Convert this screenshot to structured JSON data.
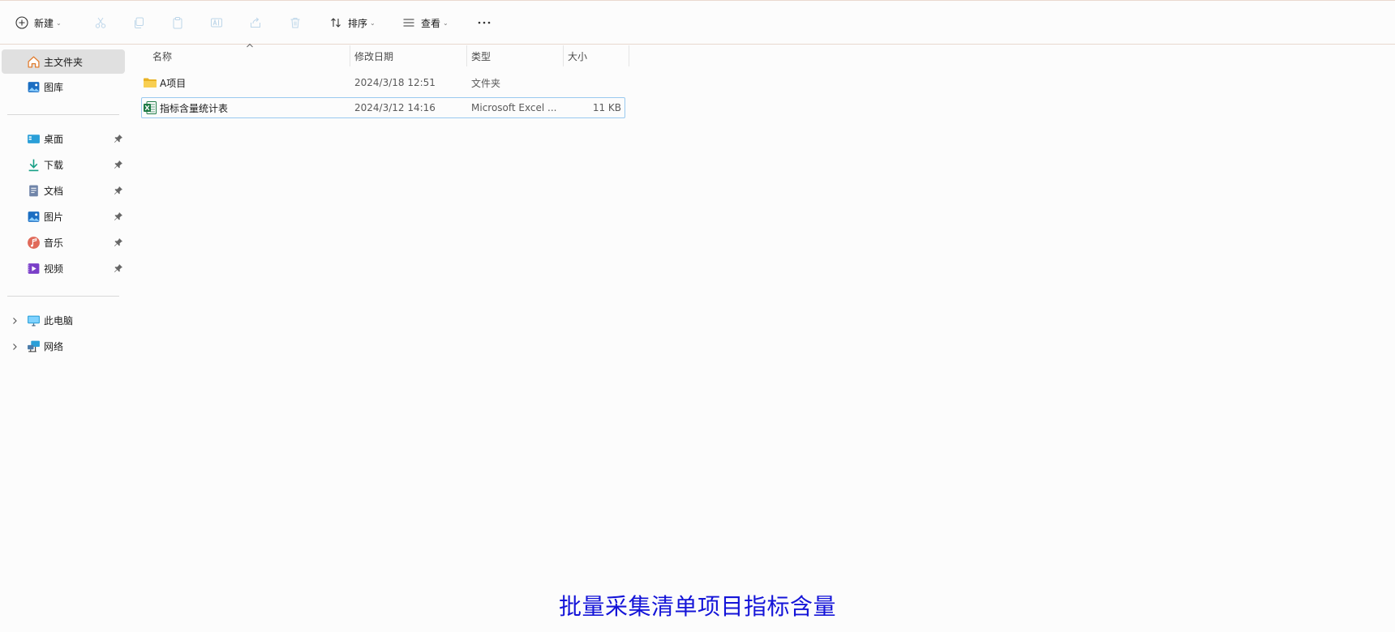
{
  "toolbar": {
    "new_label": "新建",
    "sort_label": "排序",
    "view_label": "查看",
    "more_label": "···"
  },
  "sidebar": {
    "home_label": "主文件夹",
    "gallery_label": "图库",
    "quick": [
      {
        "label": "桌面",
        "icon": "desktop-icon"
      },
      {
        "label": "下载",
        "icon": "download-icon"
      },
      {
        "label": "文档",
        "icon": "document-icon"
      },
      {
        "label": "图片",
        "icon": "pictures-icon"
      },
      {
        "label": "音乐",
        "icon": "music-icon"
      },
      {
        "label": "视频",
        "icon": "video-icon"
      }
    ],
    "this_pc_label": "此电脑",
    "network_label": "网络"
  },
  "columns": {
    "name": "名称",
    "modified": "修改日期",
    "type": "类型",
    "size": "大小"
  },
  "files": [
    {
      "name": "A项目",
      "modified": "2024/3/18 12:51",
      "type": "文件夹",
      "size": "",
      "icon": "folder-icon"
    },
    {
      "name": "指标含量统计表",
      "modified": "2024/3/12 14:16",
      "type": "Microsoft Excel ...",
      "size": "11 KB",
      "icon": "excel-icon"
    }
  ],
  "caption": "批量采集清单项目指标含量",
  "colors": {
    "caption": "#1414d8",
    "selection": "#e0e0e0",
    "focus_border": "#99c9ef"
  }
}
